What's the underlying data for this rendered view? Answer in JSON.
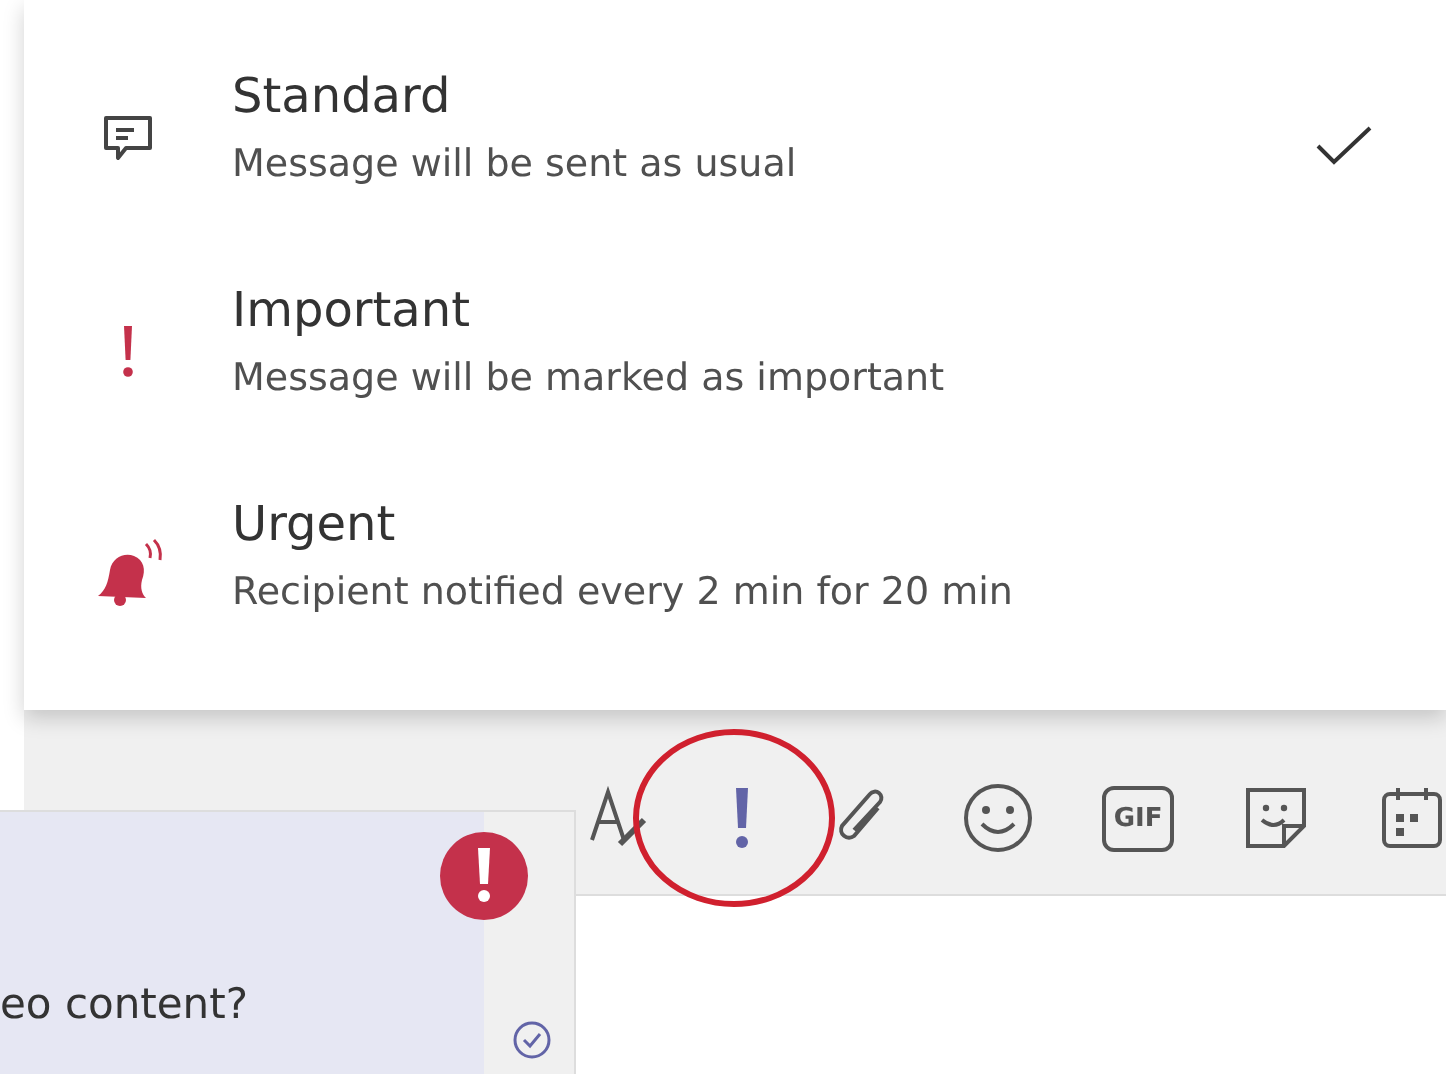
{
  "priority_menu": {
    "options": [
      {
        "kind": "standard",
        "title": "Standard",
        "description": "Message will be sent as usual",
        "selected": true
      },
      {
        "kind": "important",
        "title": "Important",
        "description": "Message will be marked as important",
        "selected": false
      },
      {
        "kind": "urgent",
        "title": "Urgent",
        "description": "Recipient notified every 2 min for 20 min",
        "selected": false
      }
    ]
  },
  "toolbar": {
    "tools": [
      {
        "kind": "format",
        "selected": false
      },
      {
        "kind": "priority",
        "selected": true
      },
      {
        "kind": "attach",
        "selected": false
      },
      {
        "kind": "emoji",
        "selected": false
      },
      {
        "kind": "gif",
        "label": "GIF",
        "selected": false
      },
      {
        "kind": "sticker",
        "selected": false
      },
      {
        "kind": "calendar",
        "selected": false
      }
    ]
  },
  "message": {
    "text": "eo content?",
    "important": true,
    "read": true
  }
}
